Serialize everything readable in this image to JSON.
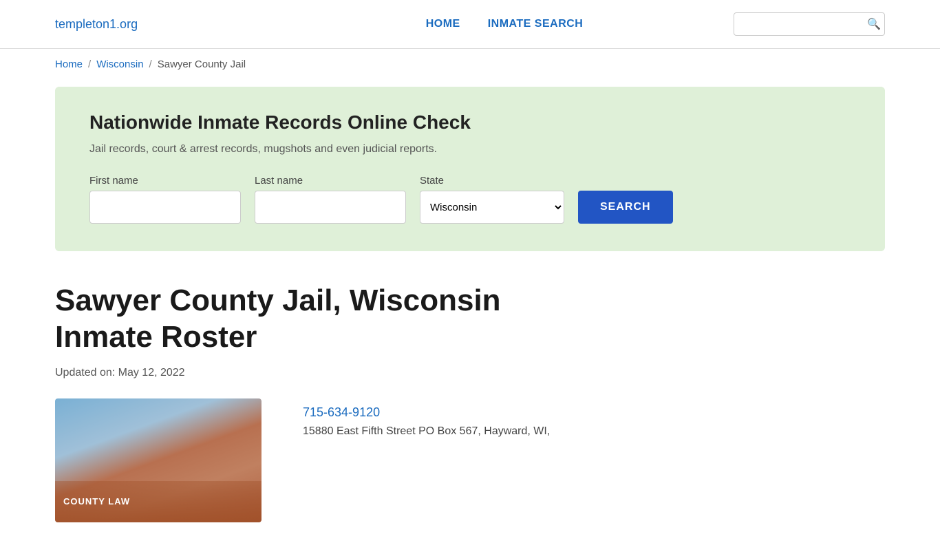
{
  "header": {
    "logo": "templeton1.org",
    "nav": {
      "home": "HOME",
      "inmate_search": "INMATE SEARCH"
    },
    "search_placeholder": ""
  },
  "breadcrumb": {
    "home": "Home",
    "state": "Wisconsin",
    "current": "Sawyer County Jail"
  },
  "search_panel": {
    "title": "Nationwide Inmate Records Online Check",
    "subtitle": "Jail records, court & arrest records, mugshots and even judicial reports.",
    "first_name_label": "First name",
    "last_name_label": "Last name",
    "state_label": "State",
    "state_value": "Wisconsin",
    "search_button": "SEARCH"
  },
  "main": {
    "page_title": "Sawyer County Jail, Wisconsin Inmate Roster",
    "updated": "Updated on: May 12, 2022",
    "phone": "715-634-9120",
    "address": "15880 East Fifth Street PO Box 567, Hayward, WI,",
    "image_text": "COUNTY LAW"
  }
}
